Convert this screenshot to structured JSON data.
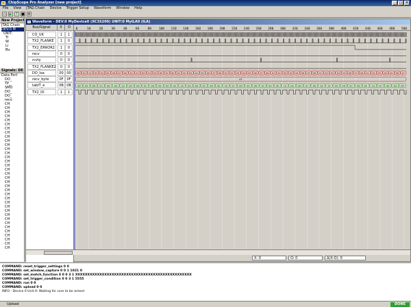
{
  "app": {
    "title": "ChipScope Pro Analyzer [new project]"
  },
  "menu": [
    "File",
    "View",
    "JTAG Chain",
    "Device",
    "Trigger Setup",
    "Waveform",
    "Window",
    "Help"
  ],
  "project_panel": {
    "title": "New Project",
    "items": [
      "JTAG Chain",
      "DEV:0 M",
      "UNIT:",
      "Tr",
      "W",
      "Li",
      "Bu"
    ]
  },
  "signals_panel": {
    "title": "Signals: DE",
    "items": [
      "Data Port",
      "DO_",
      "TP_",
      "SMD",
      "DO_",
      "DO_",
      "recv",
      "CH",
      "CH",
      "CH",
      "CH",
      "CH",
      "CH",
      "CH",
      "CH",
      "CH",
      "CH",
      "CH",
      "CH",
      "CH",
      "CH",
      "CH",
      "CH",
      "CH",
      "CH",
      "CH",
      "CH",
      "CH",
      "CH",
      "CH",
      "CH",
      "CH",
      "CH",
      "CH",
      "CH",
      "CH",
      "CH",
      "CH",
      "CH",
      "CH",
      "CH",
      "CH",
      "CH"
    ]
  },
  "waveform": {
    "title": "Waveform - DEV:0 MyDevice0 (XC3S200) UNIT:0 MyILA0 (ILA)",
    "columns": {
      "bus_signal": "Bus/Signal",
      "x": "X",
      "o": "O"
    },
    "ticks": [
      "0",
      "10",
      "20",
      "30",
      "40",
      "60",
      "80",
      "100",
      "120",
      "140",
      "160",
      "180",
      "200",
      "220",
      "240",
      "260",
      "280",
      "300",
      "320",
      "340",
      "360",
      "380",
      "400",
      "420",
      "440",
      "460",
      "480",
      "500"
    ],
    "signals": [
      {
        "name": "CO_UK",
        "x": "1",
        "o": "1"
      },
      {
        "name": "TX2_FLANKE",
        "x": "1",
        "o": "0"
      },
      {
        "name": "TX2_ERROR2",
        "x": "1",
        "o": "0"
      },
      {
        "name": "recv",
        "x": "0",
        "o": "0"
      },
      {
        "name": "rcvty",
        "x": "0",
        "o": "0"
      },
      {
        "name": "TX2_FLANKE2",
        "x": "0",
        "o": "0"
      },
      {
        "name": "DO_loa",
        "x": "00",
        "o": "00"
      },
      {
        "name": "recv_byte",
        "x": "0F",
        "o": "0F"
      },
      {
        "name": "tabIT_e",
        "x": "0B",
        "o": "0B"
      },
      {
        "name": "TX2_IO",
        "x": "1",
        "o": "1"
      }
    ],
    "bus_values": {
      "doloa": [
        "00",
        "01",
        "02",
        "03",
        "04",
        "05",
        "06",
        "07",
        "00",
        "01",
        "02",
        "03",
        "04",
        "05",
        "06",
        "07",
        "00",
        "01",
        "02",
        "03",
        "04",
        "05",
        "06",
        "07",
        "00",
        "01",
        "02",
        "03",
        "04",
        "05",
        "06",
        "07",
        "00",
        "01",
        "02",
        "03",
        "04",
        "05",
        "06",
        "07",
        "00",
        "01",
        "02",
        "03",
        "04",
        "05",
        "06",
        "07",
        "00",
        "01",
        "02",
        "03",
        "04",
        "05",
        "06",
        "07",
        "00",
        "01",
        "02",
        "03",
        "04",
        "05",
        "06",
        "07"
      ],
      "recv_byte": "0F",
      "tabit": [
        "08",
        "0A",
        "0B",
        "0C",
        "08",
        "0E",
        "10",
        "0A",
        "0B",
        "0C",
        "08",
        "08",
        "0A",
        "0E",
        "10",
        "0A",
        "0B",
        "0C",
        "08",
        "0E",
        "10",
        "0F",
        "08",
        "0A",
        "0B",
        "0C",
        "08",
        "0E",
        "10",
        "0A",
        "0B",
        "0C",
        "08",
        "0E",
        "10",
        "0A",
        "0B",
        "0C",
        "08",
        "0E",
        "10",
        "0F",
        "08",
        "0A",
        "0B"
      ]
    },
    "cursor_x": "X: 0",
    "cursor_o": "O: 0",
    "delta": "Δ(X-O): 0"
  },
  "console": [
    "COMMAND: reset_trigger_settings 0 0",
    "COMMAND: set_window_capture 0 0 1 1021 0",
    "COMMAND: set_match_function 0 0 0 3 1 XXXXXXXXXXXXXXXXXXXXXXXXXXXXXXXXXXXXXXXXXXXXXXXX",
    "COMMAND: set_trigger_condition 0 0 3 1 5555",
    "COMMAND: run 0 0",
    "COMMAND: upload 0 0",
    "INFO - Device 0 Unit 0:  Waiting for core to be armed"
  ],
  "bottom": {
    "tab": "Upload",
    "done": "DONE"
  }
}
